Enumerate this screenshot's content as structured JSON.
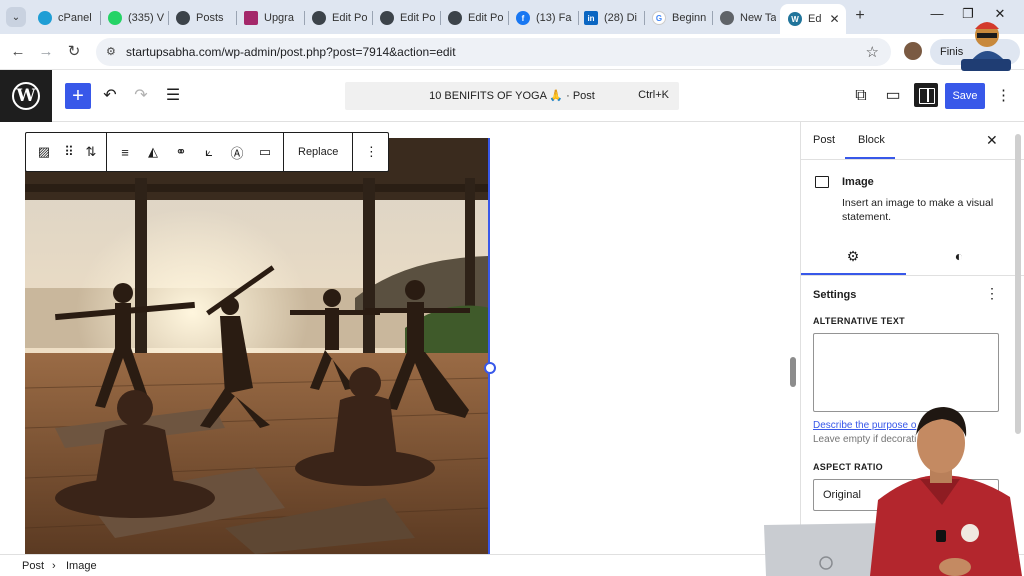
{
  "browser": {
    "tabs": [
      {
        "label": "cPanel",
        "icon": "cpanel-icon",
        "color": "#1f9ed5"
      },
      {
        "label": "(335) V",
        "icon": "whatsapp-icon",
        "color": "#25d366"
      },
      {
        "label": "Posts",
        "icon": "wp-admin-icon",
        "color": "#3c434a"
      },
      {
        "label": "Upgra",
        "icon": "yoast-icon",
        "color": "#a4286a"
      },
      {
        "label": "Edit Po",
        "icon": "wp-admin-icon",
        "color": "#3c434a"
      },
      {
        "label": "Edit Po",
        "icon": "wp-admin-icon",
        "color": "#3c434a"
      },
      {
        "label": "Edit Po",
        "icon": "wp-admin-icon",
        "color": "#3c434a"
      },
      {
        "label": "(13) Fa",
        "icon": "facebook-icon",
        "color": "#1877f2"
      },
      {
        "label": "(28) Di",
        "icon": "linkedin-icon",
        "color": "#0a66c2"
      },
      {
        "label": "Beginn",
        "icon": "google-icon",
        "color": "#4285f4"
      },
      {
        "label": "New Ta",
        "icon": "chrome-icon",
        "color": "#5f6368"
      },
      {
        "label": "Ed",
        "icon": "wordpress-icon",
        "color": "#21759b"
      }
    ],
    "url": "startupsabha.com/wp-admin/post.php?post=7914&action=edit",
    "profile_button": "Finis"
  },
  "editor": {
    "document_title": "10 BENIFITS OF YOGA 🙏 · Post",
    "shortcut": "Ctrl+K",
    "save_label": "Save",
    "accent": "#3858e9"
  },
  "block_toolbar": {
    "replace_label": "Replace"
  },
  "sidebar": {
    "tabs": [
      "Post",
      "Block"
    ],
    "active_tab": "Block",
    "block_title": "Image",
    "block_description": "Insert an image to make a visual statement.",
    "settings_title": "Settings",
    "alt_text_label": "ALTERNATIVE TEXT",
    "alt_text_value": "",
    "alt_link": "Describe the purpose o",
    "alt_help": "Leave empty if decorati",
    "aspect_ratio_label": "ASPECT RATIO",
    "aspect_ratio_value": "Original"
  },
  "breadcrumbs": {
    "root": "Post",
    "separator": "›",
    "current": "Image"
  }
}
